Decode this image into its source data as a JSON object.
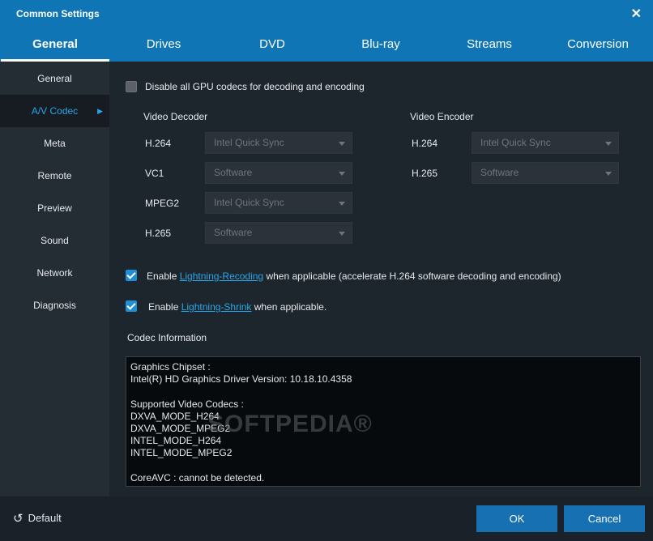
{
  "window": {
    "title": "Common Settings",
    "close_glyph": "✕"
  },
  "tabs": [
    "General",
    "Drives",
    "DVD",
    "Blu-ray",
    "Streams",
    "Conversion"
  ],
  "sidebar": {
    "items": [
      "General",
      "A/V Codec",
      "Meta",
      "Remote",
      "Preview",
      "Sound",
      "Network",
      "Diagnosis"
    ],
    "active": "A/V Codec"
  },
  "options": {
    "disable_gpu": {
      "label": "Disable all GPU codecs for decoding and encoding",
      "checked": false
    },
    "lightning_recoding": {
      "prefix": "Enable ",
      "link": "Lightning-Recoding",
      "suffix": " when applicable (accelerate H.264 software decoding and encoding)",
      "checked": true
    },
    "lightning_shrink": {
      "prefix": "Enable ",
      "link": "Lightning-Shrink",
      "suffix": " when applicable.",
      "checked": true
    }
  },
  "decoder": {
    "heading": "Video Decoder",
    "rows": [
      {
        "codec": "H.264",
        "value": "Intel Quick Sync"
      },
      {
        "codec": "VC1",
        "value": "Software"
      },
      {
        "codec": "MPEG2",
        "value": "Intel Quick Sync"
      },
      {
        "codec": "H.265",
        "value": "Software"
      }
    ]
  },
  "encoder": {
    "heading": "Video Encoder",
    "rows": [
      {
        "codec": "H.264",
        "value": "Intel Quick Sync"
      },
      {
        "codec": "H.265",
        "value": "Software"
      }
    ]
  },
  "codec_info": {
    "heading": "Codec Information",
    "lines": [
      "Graphics Chipset :",
      "Intel(R) HD Graphics Driver Version: 10.18.10.4358",
      "",
      "Supported Video Codecs :",
      "DXVA_MODE_H264",
      "DXVA_MODE_MPEG2",
      "INTEL_MODE_H264",
      "INTEL_MODE_MPEG2",
      "",
      "CoreAVC : cannot be detected."
    ]
  },
  "watermark": "SOFTPEDIA®",
  "footer": {
    "default_label": "Default",
    "default_icon": "↺",
    "ok_label": "OK",
    "cancel_label": "Cancel"
  },
  "colors": {
    "accent": "#0f75b4",
    "link": "#29a6e8",
    "button": "#1670b2"
  }
}
